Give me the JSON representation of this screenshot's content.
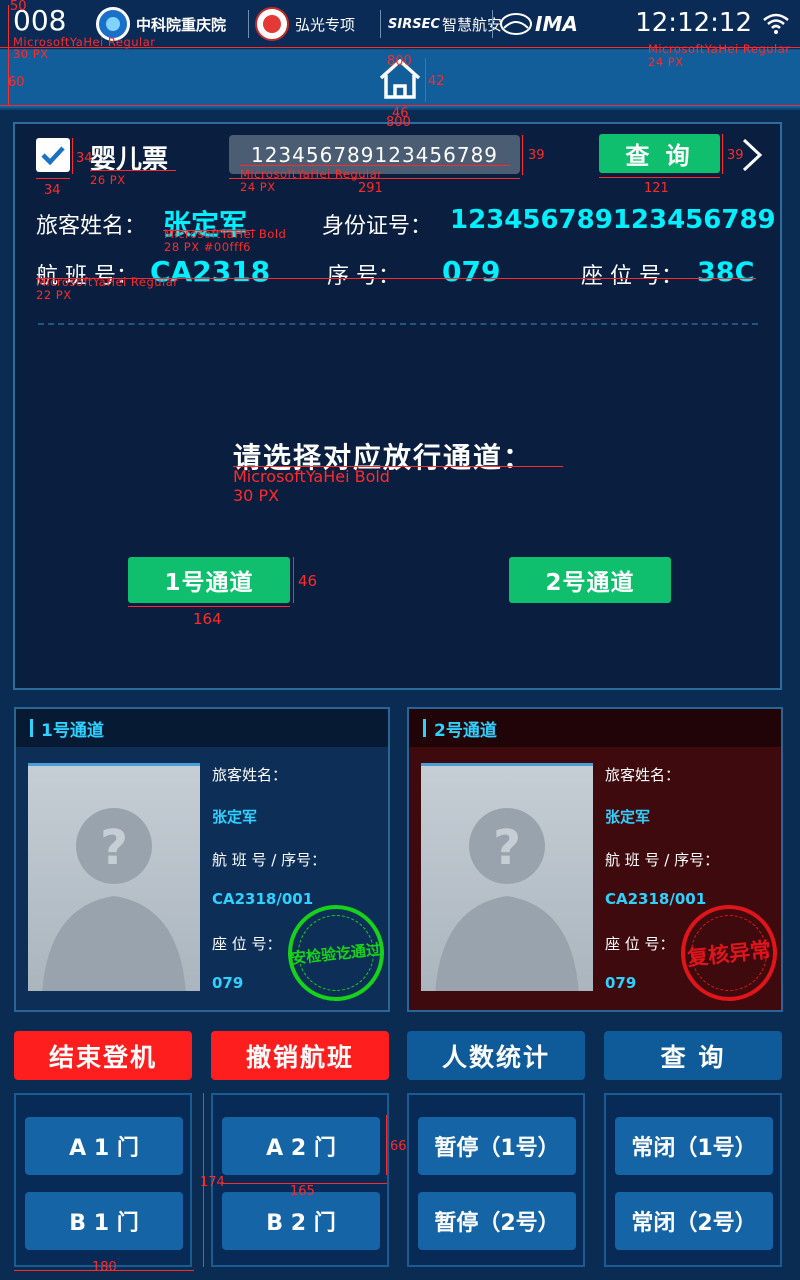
{
  "status_bar": {
    "device_number": "008",
    "logos": [
      {
        "name": "中科院重庆院"
      },
      {
        "name": "弘光专项"
      },
      {
        "name": "智慧航安",
        "prefix": "SIRSEC"
      },
      {
        "name": "IMA"
      }
    ],
    "time": "12:12:12"
  },
  "nav": {
    "home_icon": "home-icon"
  },
  "query": {
    "infant_ticket_label": "婴儿票",
    "infant_ticket_checked": true,
    "id_input_value": "123456789123456789",
    "query_button": "查  询",
    "next_icon": "chevron-right-icon"
  },
  "passenger": {
    "name_label": "旅客姓名：",
    "name_value": "张定军",
    "id_label": "身份证号：",
    "id_value": "123456789123456789",
    "flight_label": "航 班 号：",
    "flight_value": "CA2318",
    "seq_label": "序    号：",
    "seq_value": "079",
    "seat_label": "座 位 号：",
    "seat_value": "38C"
  },
  "channel_select": {
    "prompt": "请选择对应放行通道：",
    "btn1": "1号通道",
    "btn2": "2号通道"
  },
  "cards": [
    {
      "title": "1号通道",
      "name_label": "旅客姓名：",
      "name_value": "张定军",
      "flight_label": "航 班 号 / 序号：",
      "flight_value": "CA2318/001",
      "seat_label": "座 位 号：",
      "seat_value": "079",
      "stamp": "安检验讫通过",
      "stamp_color": "#17d21a"
    },
    {
      "title": "2号通道",
      "name_label": "旅客姓名：",
      "name_value": "张定军",
      "flight_label": "航 班 号 / 序号：",
      "flight_value": "CA2318/001",
      "seat_label": "座 位 号：",
      "seat_value": "079",
      "stamp": "复核异常",
      "stamp_color": "#e0141b"
    }
  ],
  "actions": {
    "end_boarding": "结束登机",
    "cancel_flight": "撤销航班",
    "statistics": "人数统计",
    "query": "查    询"
  },
  "gates": {
    "a1": "A 1 门",
    "b1": "B 1 门",
    "a2": "A 2 门",
    "b2": "B 2 门",
    "pause1": "暂停（1号）",
    "pause2": "暂停（2号）",
    "close1": "常闭（1号）",
    "close2": "常闭（2号）"
  },
  "annotations": {
    "a_50": "50",
    "a_60": "60",
    "a_font_top": "MicrosoftYaHei Regular",
    "a_30px": "30 PX",
    "a_font_clock": "MicrosoftYaHei Regular",
    "a_24px_clock": "24 PX",
    "a_800_top": "800",
    "a_42": "42",
    "a_46_icon": "46",
    "a_800_nav": "800",
    "a_34_h": "34",
    "a_34_w": "34",
    "a_26px": "26 PX",
    "a_39_input": "39",
    "a_font_input": "MicrosoftYaHei Regular",
    "a_24px_input": "24 PX",
    "a_291": "291",
    "a_39_btn": "39",
    "a_121": "121",
    "a_font_bold": "MicrosoftYaHei Bold",
    "a_28px": "28 PX  #00fff6",
    "a_font_label": "MicrosoftYaHei Regular",
    "a_22px": "22 PX",
    "a_font_prompt": "MicrosoftYaHei Bold",
    "a_30px_prompt": "30 PX",
    "a_46_btn": "46",
    "a_164": "164",
    "a_66": "66",
    "a_174": "174",
    "a_165": "165",
    "a_180": "180"
  }
}
